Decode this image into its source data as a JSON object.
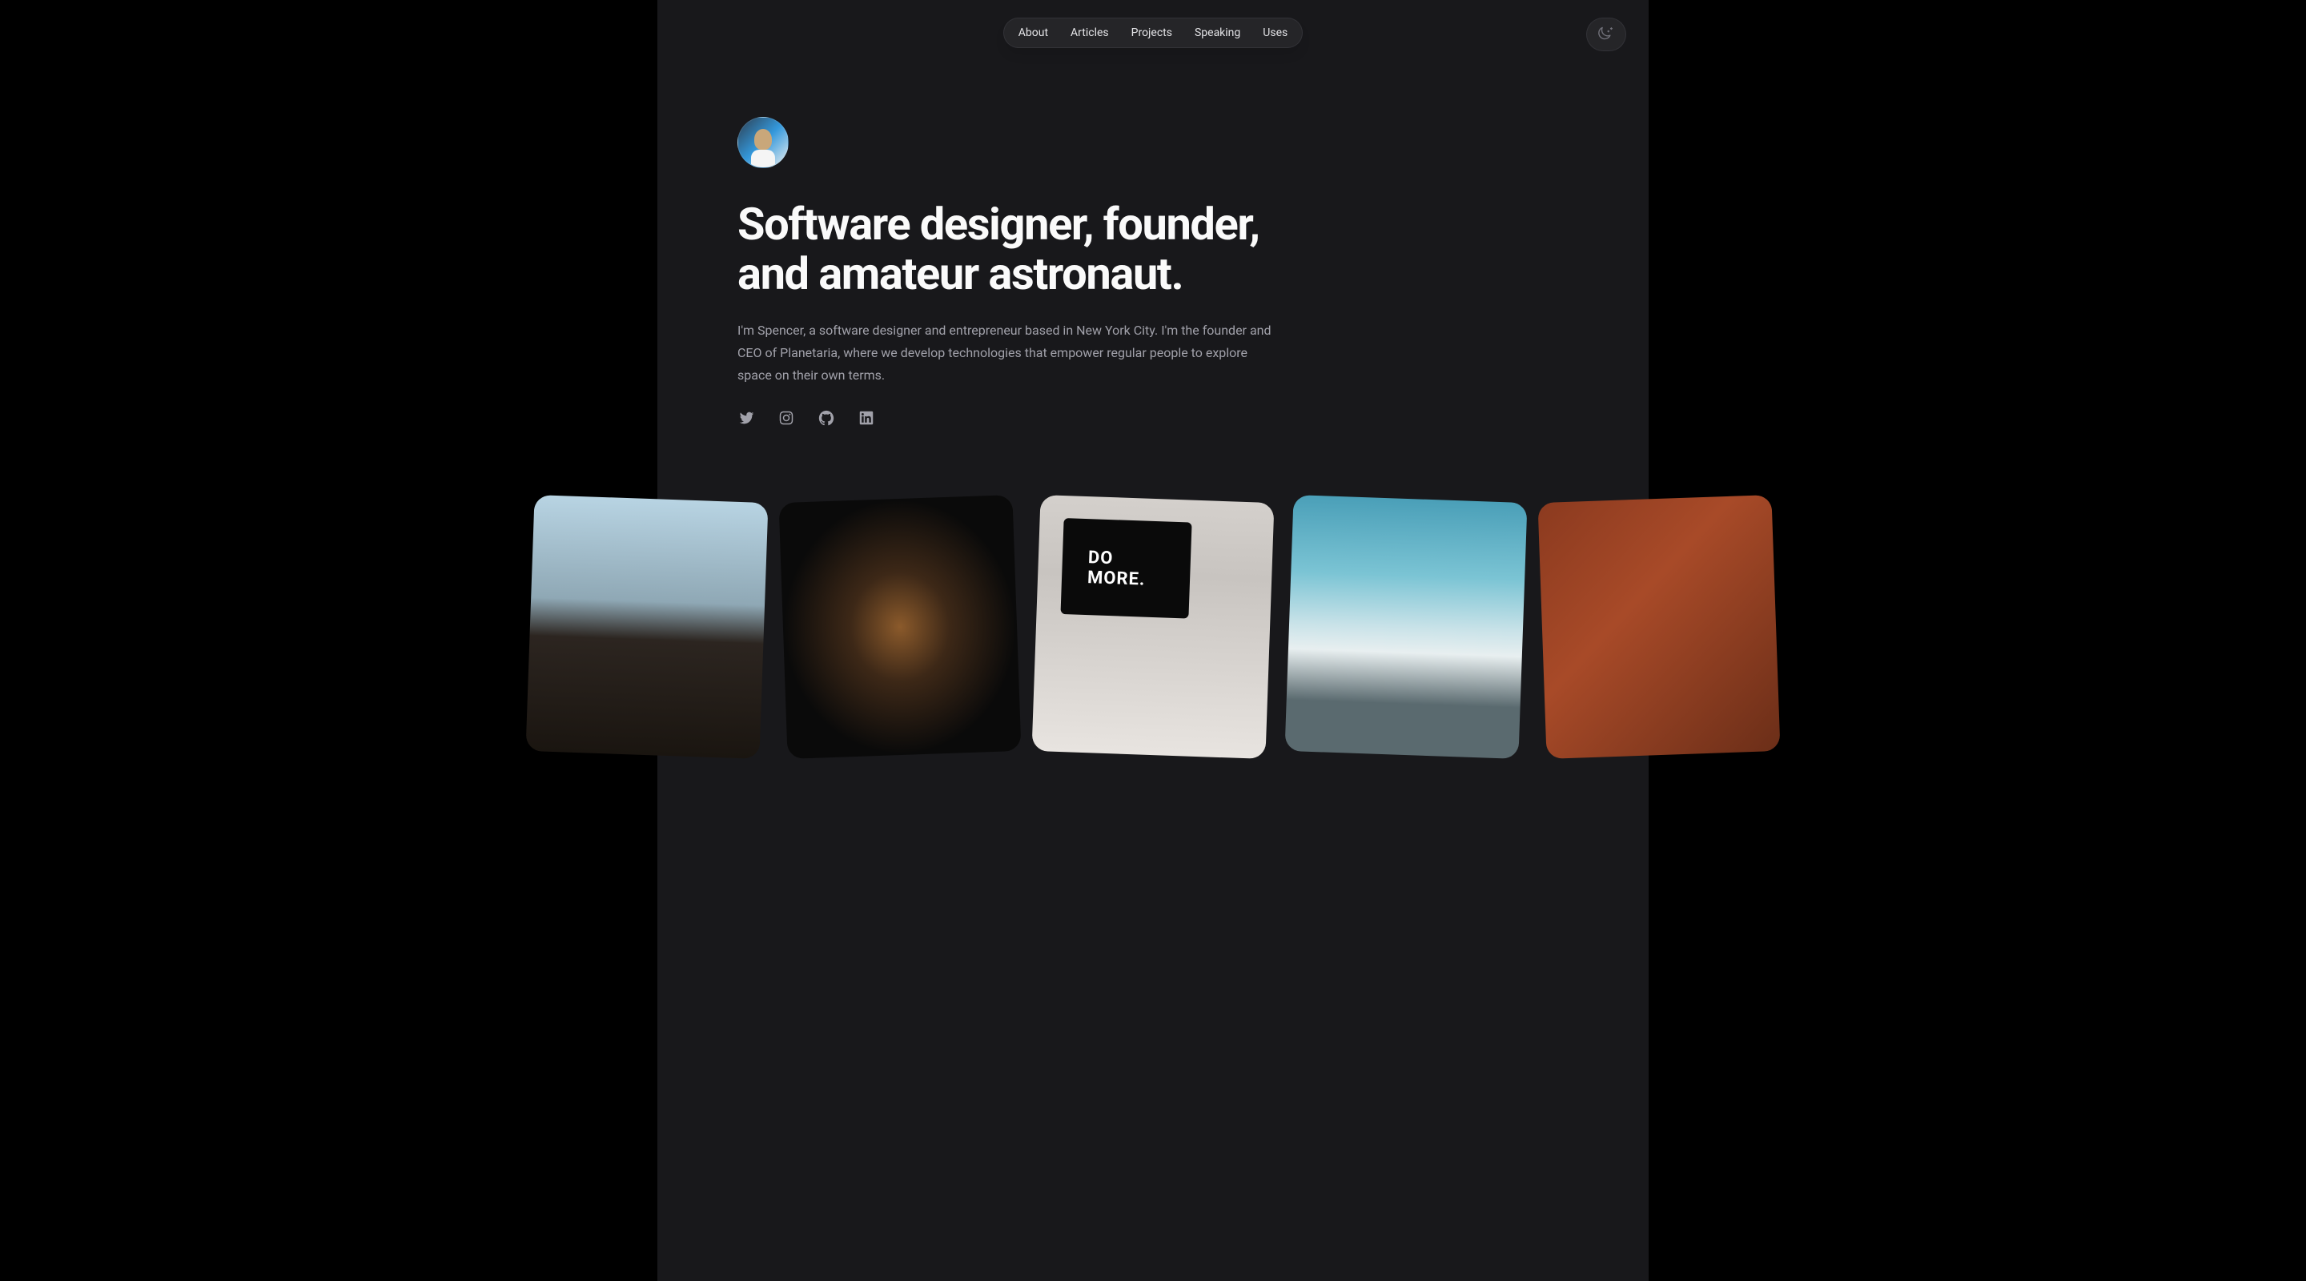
{
  "nav": {
    "items": [
      {
        "label": "About"
      },
      {
        "label": "Articles"
      },
      {
        "label": "Projects"
      },
      {
        "label": "Speaking"
      },
      {
        "label": "Uses"
      }
    ]
  },
  "hero": {
    "title": "Software designer, founder, and amateur astronaut.",
    "description": "I'm Spencer, a software designer and entrepreneur based in New York City. I'm the founder and CEO of Planetaria, where we develop technologies that empower regular people to explore space on their own terms."
  },
  "socials": {
    "twitter": "twitter",
    "instagram": "instagram",
    "github": "github",
    "linkedin": "linkedin"
  },
  "gallery": {
    "images": [
      {
        "name": "cockpit"
      },
      {
        "name": "conference"
      },
      {
        "name": "desk-do-more"
      },
      {
        "name": "mountains-clouds"
      },
      {
        "name": "mars-astronaut"
      }
    ]
  }
}
